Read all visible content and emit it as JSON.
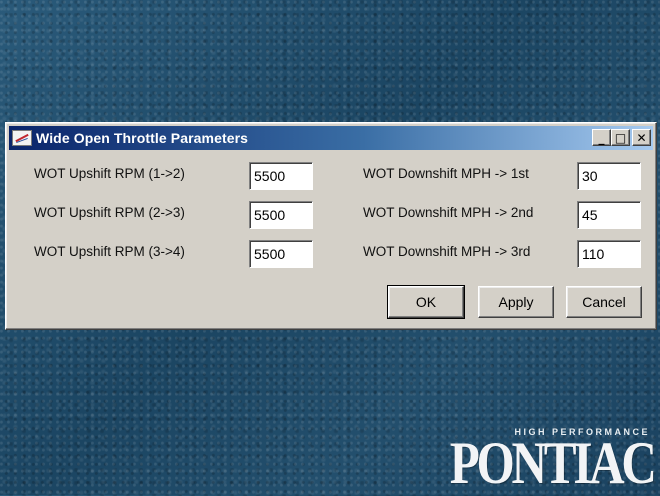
{
  "window": {
    "title": "Wide Open Throttle Parameters",
    "controls": {
      "minimize": "_",
      "maximize": "□",
      "close": "✕"
    }
  },
  "upshift": [
    {
      "label": "WOT Upshift RPM (1->2)",
      "value": "5500"
    },
    {
      "label": "WOT Upshift RPM (2->3)",
      "value": "5500"
    },
    {
      "label": "WOT Upshift RPM (3->4)",
      "value": "5500"
    }
  ],
  "downshift": [
    {
      "label": "WOT Downshift MPH -> 1st",
      "value": "30"
    },
    {
      "label": "WOT Downshift MPH -> 2nd",
      "value": "45"
    },
    {
      "label": "WOT Downshift MPH -> 3rd",
      "value": "110"
    }
  ],
  "buttons": {
    "ok": "OK",
    "apply": "Apply",
    "cancel": "Cancel"
  },
  "branding": {
    "tagline": "HIGH PERFORMANCE",
    "name": "PONTIAC"
  },
  "colors": {
    "titlebar_start": "#0a246a",
    "titlebar_end": "#a6caf0",
    "window_face": "#d4d0c8",
    "desktop": "#1f4b68"
  }
}
